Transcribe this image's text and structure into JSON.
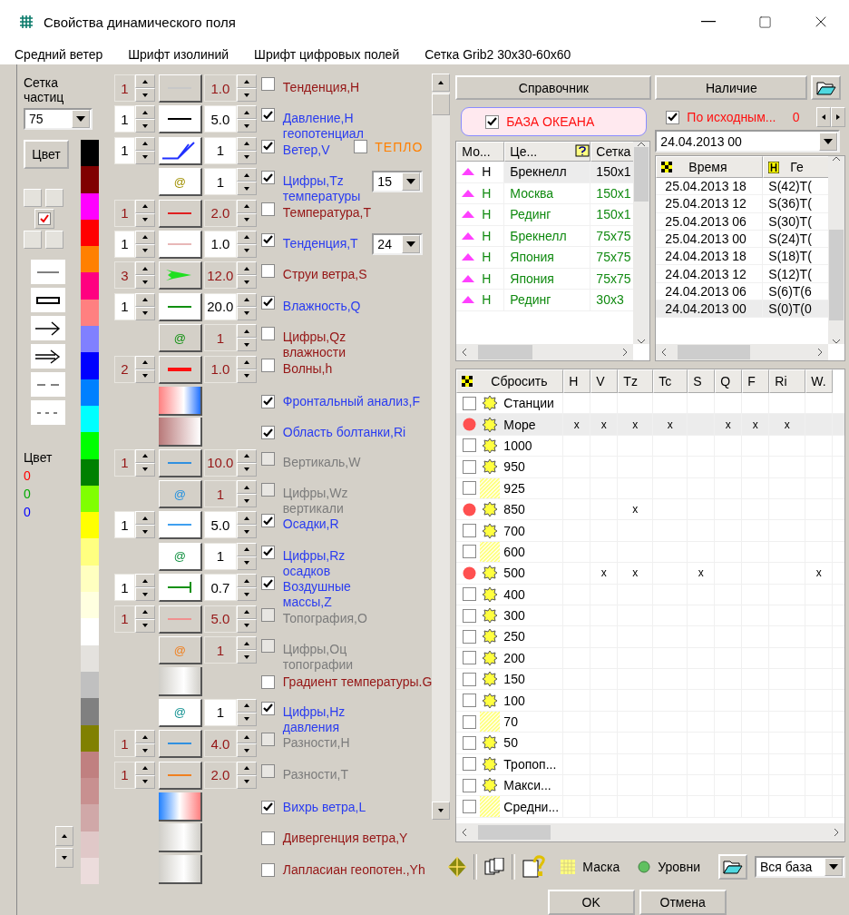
{
  "window": {
    "title": "Свойства динамического поля"
  },
  "menu": [
    "Средний ветер",
    "Шрифт изолиний",
    "Шрифт цифровых полей",
    "Сетка Grib2 30x30-60x60"
  ],
  "left_panel": {
    "grid_label": "Сетка частиц",
    "grid_value": "75",
    "color_button": "Цвет",
    "position_checked": true,
    "palette": [
      {
        "color": "#000000"
      },
      {
        "color": "#800000"
      },
      {
        "color": "#ff00ff"
      },
      {
        "color": "#ff0000"
      },
      {
        "color": "#ff8000"
      },
      {
        "color": "#ff0080"
      },
      {
        "color": "#ff8080"
      },
      {
        "color": "#8080ff"
      },
      {
        "color": "#0000ff"
      },
      {
        "color": "#0080ff"
      },
      {
        "color": "#00ffff"
      },
      {
        "color": "#00ff00"
      },
      {
        "color": "#008000"
      },
      {
        "color": "#80ff00"
      },
      {
        "color": "#ffff00"
      },
      {
        "color": "#ffff80"
      },
      {
        "color": "#ffffc0"
      },
      {
        "color": "#ffffe0"
      },
      {
        "color": "#ffffff"
      },
      {
        "color": "#e4e2de"
      },
      {
        "color": "#c0c0c0"
      },
      {
        "color": "#808080"
      },
      {
        "color": "#808000"
      },
      {
        "color": "#c08080"
      },
      {
        "color": "#c89090"
      },
      {
        "color": "#d0a8a8"
      },
      {
        "color": "#e0c8c8"
      },
      {
        "color": "#ecdcdc"
      }
    ],
    "color_readout": {
      "label": "Цвет",
      "r": "0",
      "g": "0",
      "b": "0"
    }
  },
  "layers": [
    {
      "kind": "plain",
      "count": "1",
      "color": "#c8c8c8",
      "value": "1.0",
      "checked": false,
      "disabled": false,
      "label": "Тенденция,H"
    },
    {
      "kind": "plain",
      "count": "1",
      "color": "#000000",
      "value": "5.0",
      "checked": true,
      "disabled": false,
      "label": "Давление,H геопотенциал"
    },
    {
      "kind": "barb",
      "count": "1",
      "color": "#2030ff",
      "value": "1",
      "checked": true,
      "disabled": false,
      "label": "Ветер,V",
      "extra": {
        "label": "ТЕПЛО",
        "checked": false
      }
    },
    {
      "kind": "digits",
      "symbol": "@",
      "color": "#a09000",
      "value": "1",
      "checked": true,
      "disabled": false,
      "label": "Цифры,Tz температуры",
      "period": "15"
    },
    {
      "kind": "plain",
      "count": "1",
      "color": "#e02020",
      "value": "2.0",
      "checked": false,
      "disabled": false,
      "label": "Температура,T"
    },
    {
      "kind": "plain",
      "count": "1",
      "color": "#e8b8b8",
      "value": "1.0",
      "checked": true,
      "disabled": false,
      "label": "Тенденция,T",
      "period": "24"
    },
    {
      "kind": "jet",
      "count": "3",
      "color": "#20e020",
      "value": "12.0",
      "checked": false,
      "disabled": false,
      "label": "Струи ветра,S"
    },
    {
      "kind": "plain",
      "count": "1",
      "color": "#109010",
      "value": "20.0",
      "checked": true,
      "disabled": false,
      "label": "Влажность,Q"
    },
    {
      "kind": "digits",
      "symbol": "@",
      "color": "#109010",
      "value": "1",
      "checked": false,
      "disabled": false,
      "label": "Цифры,Qz влажности"
    },
    {
      "kind": "thick",
      "count": "2",
      "color": "#ff1010",
      "value": "1.0",
      "checked": false,
      "disabled": false,
      "label": "Волны,h"
    },
    {
      "kind": "front",
      "checked": true,
      "disabled": false,
      "label": "Фронтальный анализ,F"
    },
    {
      "kind": "turbulence",
      "checked": true,
      "disabled": false,
      "label": "Область болтанки,Ri"
    },
    {
      "kind": "plain",
      "count": "1",
      "color": "#3090e0",
      "value": "10.0",
      "checked": false,
      "disabled": true,
      "label": "Вертикаль,W"
    },
    {
      "kind": "digits",
      "symbol": "@",
      "color": "#2090e0",
      "value": "1",
      "checked": false,
      "disabled": true,
      "label": "Цифры,Wz вертикали"
    },
    {
      "kind": "plain",
      "count": "1",
      "color": "#40a0f0",
      "value": "5.0",
      "checked": true,
      "disabled": false,
      "label": "Осадки,R"
    },
    {
      "kind": "digits",
      "symbol": "@",
      "color": "#109040",
      "value": "1",
      "checked": true,
      "disabled": false,
      "label": "Цифры,Rz осадков"
    },
    {
      "kind": "end",
      "count": "1",
      "color": "#109010",
      "value": "0.7",
      "checked": true,
      "disabled": false,
      "label": "Воздушные массы,Z"
    },
    {
      "kind": "plain",
      "count": "1",
      "color": "#f09090",
      "value": "5.0",
      "checked": false,
      "disabled": true,
      "label": "Топография,O"
    },
    {
      "kind": "digits",
      "symbol": "@",
      "color": "#f08020",
      "value": "1",
      "checked": false,
      "disabled": true,
      "label": "Цифры,Oц топографии"
    },
    {
      "kind": "shade",
      "checked": false,
      "disabled": false,
      "label": "Градиент температуры.G"
    },
    {
      "kind": "digits",
      "symbol": "@",
      "color": "#109090",
      "value": "1",
      "checked": true,
      "disabled": false,
      "label": "Цифры,Hz давления"
    },
    {
      "kind": "plain",
      "count": "1",
      "color": "#3090e0",
      "value": "4.0",
      "checked": false,
      "disabled": true,
      "label": "Разности,H"
    },
    {
      "kind": "plain",
      "count": "1",
      "color": "#f08020",
      "value": "2.0",
      "checked": false,
      "disabled": true,
      "label": "Разности,T"
    },
    {
      "kind": "vortex",
      "checked": true,
      "disabled": false,
      "label": "Вихрь ветра,L"
    },
    {
      "kind": "shade",
      "checked": false,
      "disabled": false,
      "label": "Дивергенция ветра,Y"
    },
    {
      "kind": "shade",
      "checked": false,
      "disabled": false,
      "label": "Лапласиан геопотен.,Yh"
    }
  ],
  "reference_button": "Справочник",
  "availability_button": "Наличие",
  "ocean_base": {
    "label": "БАЗА ОКЕАНА",
    "checked": true
  },
  "source_filter": {
    "label": "По исходным...",
    "checked": true,
    "count": "0"
  },
  "date_select": "24.04.2013 00",
  "models": {
    "columns": [
      "Мо...",
      "Це...",
      "Сетка"
    ],
    "rows": [
      {
        "type": "H",
        "center": "Брекнелл",
        "grid": "150x1",
        "selected": true
      },
      {
        "type": "H",
        "center": "Москва",
        "grid": "150x1",
        "selected": false
      },
      {
        "type": "H",
        "center": "Рединг",
        "grid": "150x1",
        "selected": false
      },
      {
        "type": "H",
        "center": "Брекнелл",
        "grid": "75x75",
        "selected": false
      },
      {
        "type": "H",
        "center": "Япония",
        "grid": "75x75",
        "selected": false
      },
      {
        "type": "H",
        "center": "Япония",
        "grid": "75x75",
        "selected": false
      },
      {
        "type": "H",
        "center": "Рединг",
        "grid": "30x3",
        "selected": false
      }
    ]
  },
  "times": {
    "columns": [
      "Время",
      "Ге"
    ],
    "rows": [
      {
        "time": "25.04.2013 18",
        "value": "S(42)T(",
        "selected": false
      },
      {
        "time": "25.04.2013 12",
        "value": "S(36)T(",
        "selected": false
      },
      {
        "time": "25.04.2013 06",
        "value": "S(30)T(",
        "selected": false
      },
      {
        "time": "25.04.2013 00",
        "value": "S(24)T(",
        "selected": false
      },
      {
        "time": "24.04.2013 18",
        "value": "S(18)T(",
        "selected": false
      },
      {
        "time": "24.04.2013 12",
        "value": "S(12)T(",
        "selected": false
      },
      {
        "time": "24.04.2013 06",
        "value": "S(6)T(6",
        "selected": false
      },
      {
        "time": "24.04.2013 00",
        "value": "S(0)T(0",
        "selected": true
      }
    ]
  },
  "levels": {
    "reset": "Сбросить",
    "columns": [
      "H",
      "V",
      "Tz",
      "Tc",
      "S",
      "Q",
      "F",
      "Ri",
      "W."
    ],
    "rows": [
      {
        "label": "Станции",
        "marked": false,
        "kind": "sun",
        "selected": false,
        "cells": [
          null,
          null,
          null,
          null,
          null,
          null,
          null,
          null,
          null
        ]
      },
      {
        "label": "Море",
        "marked": true,
        "kind": "sun",
        "selected": true,
        "cells": [
          "x",
          "x",
          "x",
          "x",
          null,
          "x",
          "x",
          "x",
          null
        ]
      },
      {
        "label": "1000",
        "marked": false,
        "kind": "sun",
        "selected": false,
        "cells": [
          null,
          null,
          null,
          null,
          null,
          null,
          null,
          null,
          null
        ]
      },
      {
        "label": "950",
        "marked": false,
        "kind": "sun",
        "selected": false,
        "cells": [
          null,
          null,
          null,
          null,
          null,
          null,
          null,
          null,
          null
        ]
      },
      {
        "label": "925",
        "marked": false,
        "kind": "hatched",
        "selected": false,
        "cells": [
          null,
          null,
          null,
          null,
          null,
          null,
          null,
          null,
          null
        ]
      },
      {
        "label": "850",
        "marked": true,
        "kind": "sun",
        "selected": false,
        "cells": [
          null,
          null,
          "x",
          null,
          null,
          null,
          null,
          null,
          null
        ]
      },
      {
        "label": "700",
        "marked": false,
        "kind": "sun",
        "selected": false,
        "cells": [
          null,
          null,
          null,
          null,
          null,
          null,
          null,
          null,
          null
        ]
      },
      {
        "label": "600",
        "marked": false,
        "kind": "hatched",
        "selected": false,
        "cells": [
          null,
          null,
          null,
          null,
          null,
          null,
          null,
          null,
          null
        ]
      },
      {
        "label": "500",
        "marked": true,
        "kind": "sun",
        "selected": false,
        "cells": [
          null,
          "x",
          "x",
          null,
          "x",
          null,
          null,
          null,
          "x"
        ]
      },
      {
        "label": "400",
        "marked": false,
        "kind": "sun",
        "selected": false,
        "cells": [
          null,
          null,
          null,
          null,
          null,
          null,
          null,
          null,
          null
        ]
      },
      {
        "label": "300",
        "marked": false,
        "kind": "sun",
        "selected": false,
        "cells": [
          null,
          null,
          null,
          null,
          null,
          null,
          null,
          null,
          null
        ]
      },
      {
        "label": "250",
        "marked": false,
        "kind": "sun",
        "selected": false,
        "cells": [
          null,
          null,
          null,
          null,
          null,
          null,
          null,
          null,
          null
        ]
      },
      {
        "label": "200",
        "marked": false,
        "kind": "sun",
        "selected": false,
        "cells": [
          null,
          null,
          null,
          null,
          null,
          null,
          null,
          null,
          null
        ]
      },
      {
        "label": "150",
        "marked": false,
        "kind": "sun",
        "selected": false,
        "cells": [
          null,
          null,
          null,
          null,
          null,
          null,
          null,
          null,
          null
        ]
      },
      {
        "label": "100",
        "marked": false,
        "kind": "sun",
        "selected": false,
        "cells": [
          null,
          null,
          null,
          null,
          null,
          null,
          null,
          null,
          null
        ]
      },
      {
        "label": "70",
        "marked": false,
        "kind": "hatched",
        "selected": false,
        "cells": [
          null,
          null,
          null,
          null,
          null,
          null,
          null,
          null,
          null
        ]
      },
      {
        "label": "50",
        "marked": false,
        "kind": "sun",
        "selected": false,
        "cells": [
          null,
          null,
          null,
          null,
          null,
          null,
          null,
          null,
          null
        ]
      },
      {
        "label": "Тропоп...",
        "marked": false,
        "kind": "sun",
        "selected": false,
        "cells": [
          null,
          null,
          null,
          null,
          null,
          null,
          null,
          null,
          null
        ]
      },
      {
        "label": "Макси...",
        "marked": false,
        "kind": "sun",
        "selected": false,
        "cells": [
          null,
          null,
          null,
          null,
          null,
          null,
          null,
          null,
          null
        ]
      },
      {
        "label": "Средни...",
        "marked": false,
        "kind": "hatched",
        "selected": false,
        "cells": [
          null,
          null,
          null,
          null,
          null,
          null,
          null,
          null,
          null
        ]
      }
    ]
  },
  "toolbar": {
    "mask": "Маска",
    "levels": "Уровни",
    "scope": "Вся база"
  },
  "buttons": [
    "OK",
    "Отмена"
  ]
}
